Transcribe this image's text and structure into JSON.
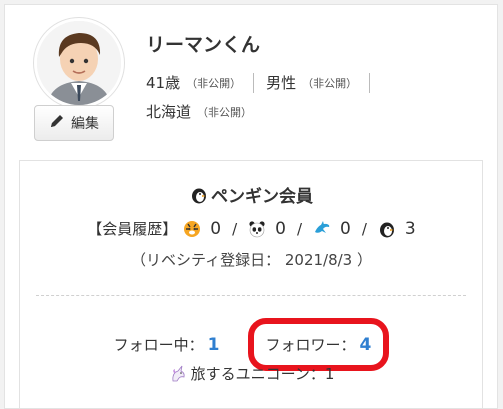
{
  "profile": {
    "name": "リーマンくん",
    "age": "41歳",
    "age_privacy": "（非公開）",
    "gender": "男性",
    "gender_privacy": "（非公開）",
    "region": "北海道",
    "region_privacy": "（非公開）",
    "edit_label": "編集"
  },
  "membership": {
    "title": "ペンギン会員",
    "history_label": "【会員履歴】",
    "history": [
      {
        "icon": "tiger-icon",
        "count": "0"
      },
      {
        "icon": "panda-icon",
        "count": "0"
      },
      {
        "icon": "dolphin-icon",
        "count": "0"
      },
      {
        "icon": "penguin-icon",
        "count": "3"
      }
    ],
    "separator": "/",
    "registration": "（リベシティ登録日： 2021/8/3 ）"
  },
  "follow": {
    "following_label": "フォロー中：",
    "following_count": "1",
    "followers_label": "フォロワー：",
    "followers_count": "4",
    "unicorn_label": "旅するユニコーン：1"
  },
  "colors": {
    "accent_blue": "#2f7fd0",
    "highlight_red": "#e8141d"
  }
}
